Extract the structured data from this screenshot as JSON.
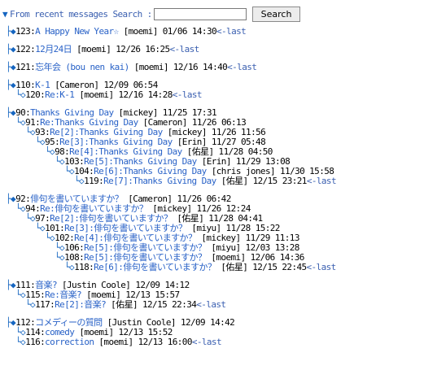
{
  "top": {
    "label": "From recent messages Search :",
    "search_placeholder": "",
    "search_button": "Search"
  },
  "threads": [
    {
      "rows": [
        {
          "indent": 0,
          "kind": "filled",
          "num": "123:",
          "subject": "A Happy New Year☆",
          "meta": " [moemi] 01/06 14:30",
          "last": "<-last"
        }
      ]
    },
    {
      "rows": [
        {
          "indent": 0,
          "kind": "filled",
          "num": "122:",
          "subject": "12月24日",
          "meta": " [moemi] 12/26 16:25",
          "last": "<-last"
        }
      ]
    },
    {
      "rows": [
        {
          "indent": 0,
          "kind": "filled",
          "num": "121:",
          "subject": "忘年会 (bou nen kai)",
          "meta": " [moemi] 12/16 14:40",
          "last": "<-last"
        }
      ]
    },
    {
      "rows": [
        {
          "indent": 0,
          "kind": "filled",
          "num": "110:",
          "subject": "K-1",
          "meta": " [Cameron] 12/09 06:54",
          "last": ""
        },
        {
          "indent": 1,
          "kind": "open",
          "num": "120:",
          "subject": "Re:K-1",
          "meta": " [moemi] 12/16 14:28",
          "last": "<-last"
        }
      ]
    },
    {
      "rows": [
        {
          "indent": 0,
          "kind": "filled",
          "num": "90:",
          "subject": "Thanks Giving Day",
          "meta": " [mickey] 11/25 17:31",
          "last": ""
        },
        {
          "indent": 1,
          "kind": "open",
          "num": "91:",
          "subject": "Re:Thanks Giving Day",
          "meta": " [Cameron] 11/26 06:13",
          "last": ""
        },
        {
          "indent": 2,
          "kind": "open",
          "num": "93:",
          "subject": "Re[2]:Thanks Giving Day",
          "meta": " [mickey] 11/26 11:56",
          "last": ""
        },
        {
          "indent": 3,
          "kind": "open",
          "num": "95:",
          "subject": "Re[3]:Thanks Giving Day",
          "meta": " [Erin] 11/27 05:48",
          "last": ""
        },
        {
          "indent": 4,
          "kind": "open",
          "num": "98:",
          "subject": "Re[4]:Thanks Giving Day",
          "meta": " [佑星] 11/28 04:50",
          "last": ""
        },
        {
          "indent": 5,
          "kind": "open",
          "num": "103:",
          "subject": "Re[5]:Thanks Giving Day",
          "meta": " [Erin] 11/29 13:08",
          "last": ""
        },
        {
          "indent": 6,
          "kind": "open",
          "num": "104:",
          "subject": "Re[6]:Thanks Giving Day",
          "meta": " [chris jones] 11/30 15:58",
          "last": ""
        },
        {
          "indent": 7,
          "kind": "open",
          "num": "119:",
          "subject": "Re[7]:Thanks Giving Day",
          "meta": " [佑星] 12/15 23:21",
          "last": "<-last"
        }
      ]
    },
    {
      "rows": [
        {
          "indent": 0,
          "kind": "filled",
          "num": "92:",
          "subject": "俳句を書いていますか？",
          "meta": " [Cameron] 11/26 06:42",
          "last": ""
        },
        {
          "indent": 1,
          "kind": "open",
          "num": "94:",
          "subject": "Re:俳句を書いていますか？",
          "meta": " [mickey] 11/26 12:24",
          "last": ""
        },
        {
          "indent": 2,
          "kind": "open",
          "num": "97:",
          "subject": "Re[2]:俳句を書いていますか？",
          "meta": " [佑星] 11/28 04:41",
          "last": ""
        },
        {
          "indent": 3,
          "kind": "open",
          "num": "101:",
          "subject": "Re[3]:俳句を書いていますか？",
          "meta": " [miyu] 11/28 15:22",
          "last": ""
        },
        {
          "indent": 4,
          "kind": "open",
          "num": "102:",
          "subject": "Re[4]:俳句を書いていますか？",
          "meta": " [mickey] 11/29 11:13",
          "last": ""
        },
        {
          "indent": 5,
          "kind": "open",
          "num": "106:",
          "subject": "Re[5]:俳句を書いていますか？",
          "meta": " [miyu] 12/03 13:28",
          "last": ""
        },
        {
          "indent": 5,
          "kind": "open",
          "num": "108:",
          "subject": "Re[5]:俳句を書いていますか？",
          "meta": " [moemi] 12/06 14:36",
          "last": ""
        },
        {
          "indent": 6,
          "kind": "open",
          "num": "118:",
          "subject": "Re[6]:俳句を書いていますか？",
          "meta": " [佑星] 12/15 22:45",
          "last": "<-last"
        }
      ]
    },
    {
      "rows": [
        {
          "indent": 0,
          "kind": "filled",
          "num": "111:",
          "subject": "音楽?",
          "meta": " [Justin Coole] 12/09 14:12",
          "last": ""
        },
        {
          "indent": 1,
          "kind": "open",
          "num": "115:",
          "subject": "Re:音楽?",
          "meta": " [moemi] 12/13 15:57",
          "last": ""
        },
        {
          "indent": 2,
          "kind": "open",
          "num": "117:",
          "subject": "Re[2]:音楽?",
          "meta": " [佑星] 12/15 22:34",
          "last": "<-last"
        }
      ]
    },
    {
      "rows": [
        {
          "indent": 0,
          "kind": "filled",
          "num": "112:",
          "subject": "コメディーの質問",
          "meta": " [Justin Coole] 12/09 14:42",
          "last": ""
        },
        {
          "indent": 1,
          "kind": "open",
          "num": "114:",
          "subject": "comedy",
          "meta": " [moemi] 12/13 15:52",
          "last": ""
        },
        {
          "indent": 1,
          "kind": "open",
          "num": "116:",
          "subject": "correction",
          "meta": " [moemi] 12/13 16:00",
          "last": "<-last"
        }
      ]
    }
  ]
}
